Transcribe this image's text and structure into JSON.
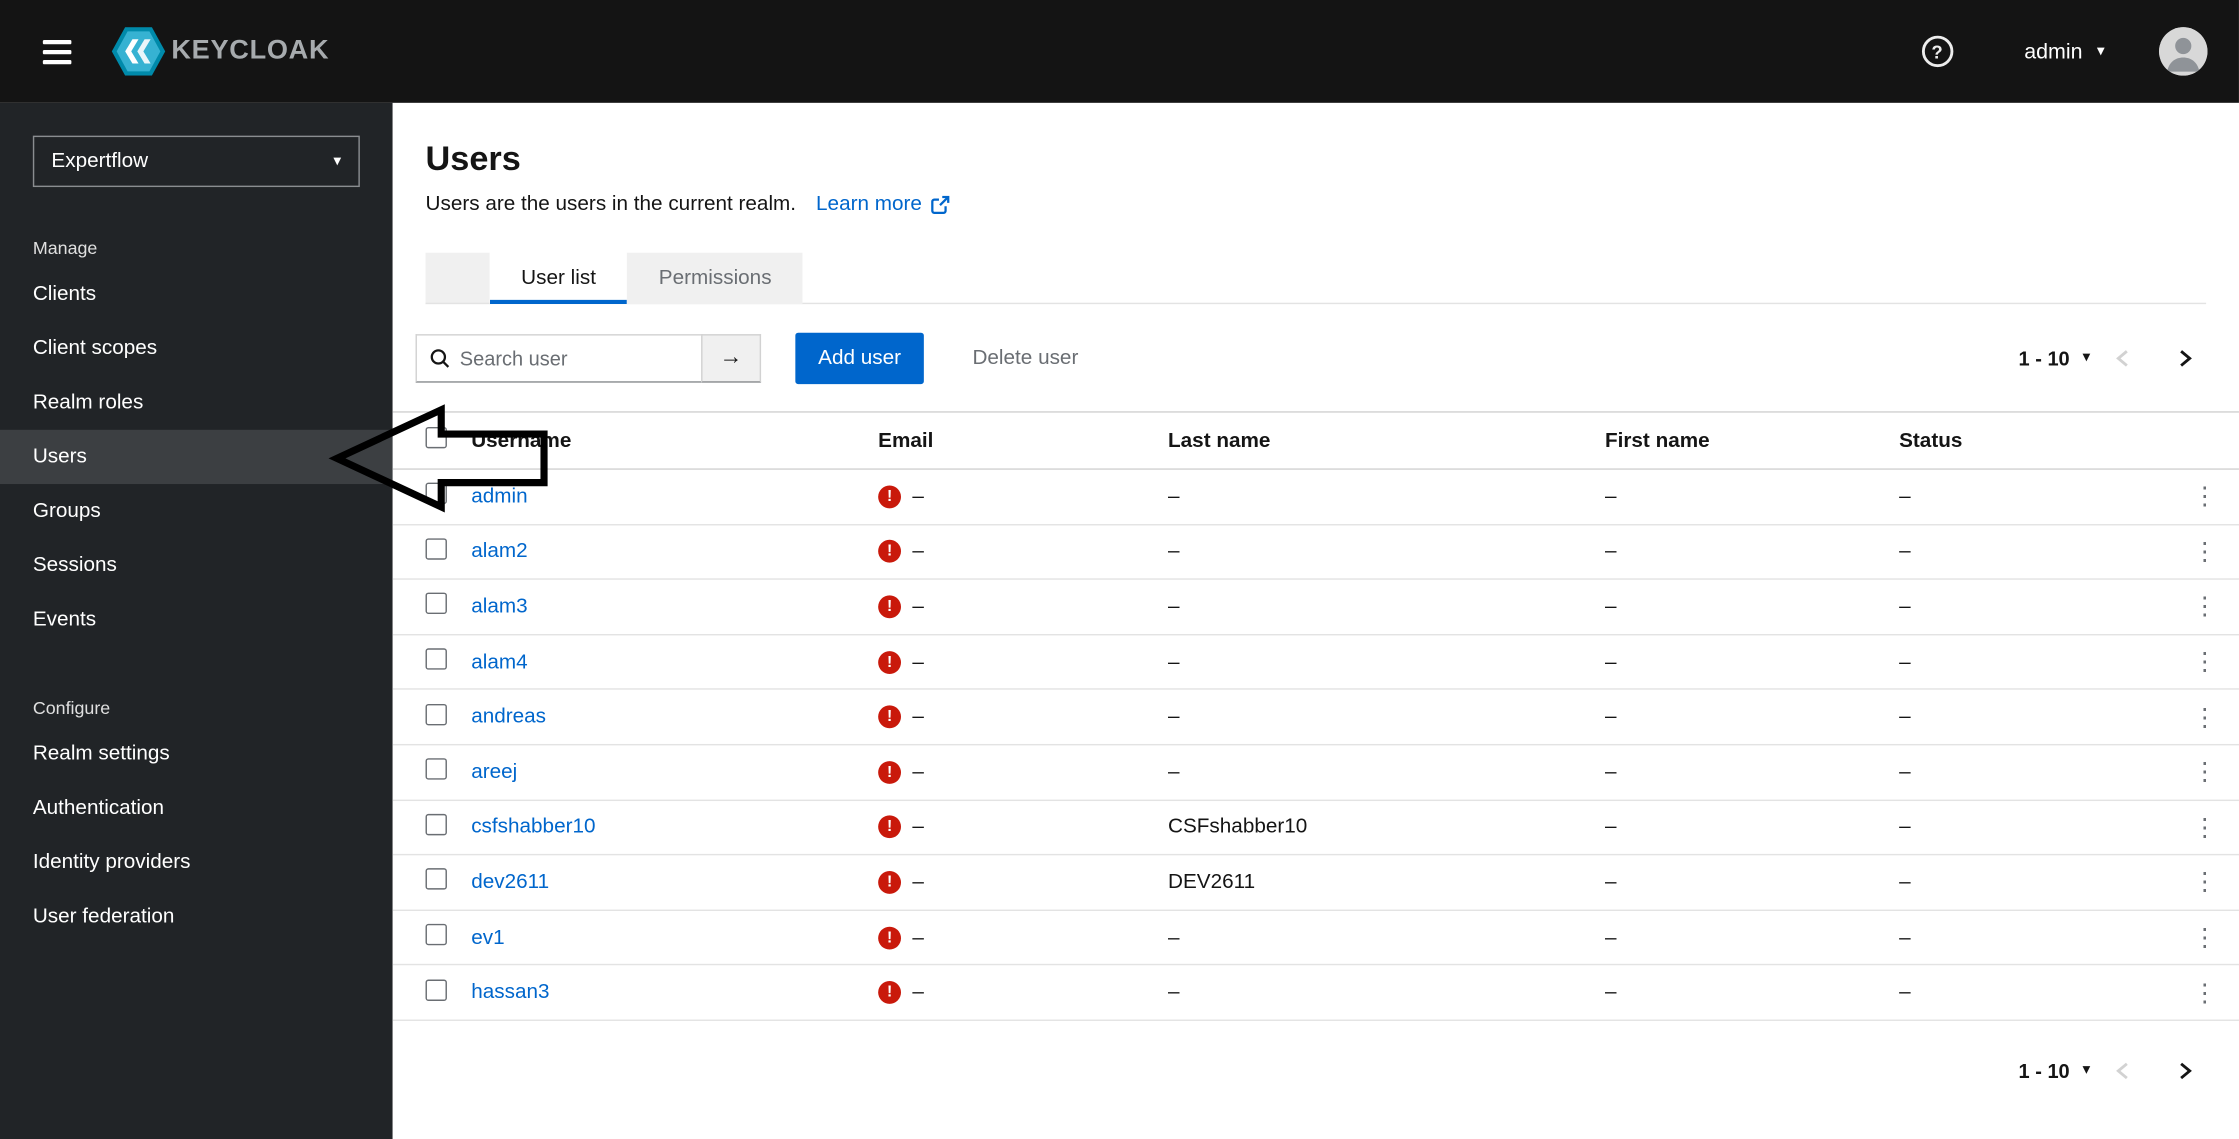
{
  "header": {
    "brand": "KEYCLOAK",
    "username": "admin"
  },
  "icons": {
    "help": "?",
    "caret": "▾",
    "kebab": "⋮",
    "search_arrow": "→",
    "warning": "!"
  },
  "sidebar": {
    "realm_selector": "Expertflow",
    "sections": [
      {
        "label": "Manage",
        "items": [
          {
            "label": "Clients",
            "selected": false
          },
          {
            "label": "Client scopes",
            "selected": false
          },
          {
            "label": "Realm roles",
            "selected": false
          },
          {
            "label": "Users",
            "selected": true
          },
          {
            "label": "Groups",
            "selected": false
          },
          {
            "label": "Sessions",
            "selected": false
          },
          {
            "label": "Events",
            "selected": false
          }
        ]
      },
      {
        "label": "Configure",
        "items": [
          {
            "label": "Realm settings",
            "selected": false
          },
          {
            "label": "Authentication",
            "selected": false
          },
          {
            "label": "Identity providers",
            "selected": false
          },
          {
            "label": "User federation",
            "selected": false
          }
        ]
      }
    ]
  },
  "main": {
    "page_title": "Users",
    "subtitle": "Users are the users in the current realm.",
    "learn_more_label": "Learn more",
    "tabs": [
      {
        "label": "User list",
        "active": true
      },
      {
        "label": "Permissions",
        "active": false
      }
    ],
    "toolbar": {
      "search_placeholder": "Search user",
      "add_user_label": "Add user",
      "delete_user_label": "Delete user",
      "pagination_label": "1 - 10"
    },
    "table": {
      "columns": [
        "Username",
        "Email",
        "Last name",
        "First name",
        "Status"
      ],
      "rows": [
        {
          "username": "admin",
          "email": "–",
          "last_name": "–",
          "first_name": "–",
          "status": "–"
        },
        {
          "username": "alam2",
          "email": "–",
          "last_name": "–",
          "first_name": "–",
          "status": "–"
        },
        {
          "username": "alam3",
          "email": "–",
          "last_name": "–",
          "first_name": "–",
          "status": "–"
        },
        {
          "username": "alam4",
          "email": "–",
          "last_name": "–",
          "first_name": "–",
          "status": "–"
        },
        {
          "username": "andreas",
          "email": "–",
          "last_name": "–",
          "first_name": "–",
          "status": "–"
        },
        {
          "username": "areej",
          "email": "–",
          "last_name": "–",
          "first_name": "–",
          "status": "–"
        },
        {
          "username": "csfshabber10",
          "email": "–",
          "last_name": "CSFshabber10",
          "first_name": "–",
          "status": "–"
        },
        {
          "username": "dev2611",
          "email": "–",
          "last_name": "DEV2611",
          "first_name": "–",
          "status": "–"
        },
        {
          "username": "ev1",
          "email": "–",
          "last_name": "–",
          "first_name": "–",
          "status": "–"
        },
        {
          "username": "hassan3",
          "email": "–",
          "last_name": "–",
          "first_name": "–",
          "status": "–"
        }
      ]
    },
    "footer_pagination_label": "1 - 10"
  },
  "colors": {
    "primary": "#0066cc",
    "link": "#0066cc",
    "danger": "#c9190b",
    "header_bg": "#141414",
    "sidebar_bg": "#212427",
    "sidebar_selected_bg": "#3c3f42",
    "tab_active_underline": "#0066cc"
  }
}
